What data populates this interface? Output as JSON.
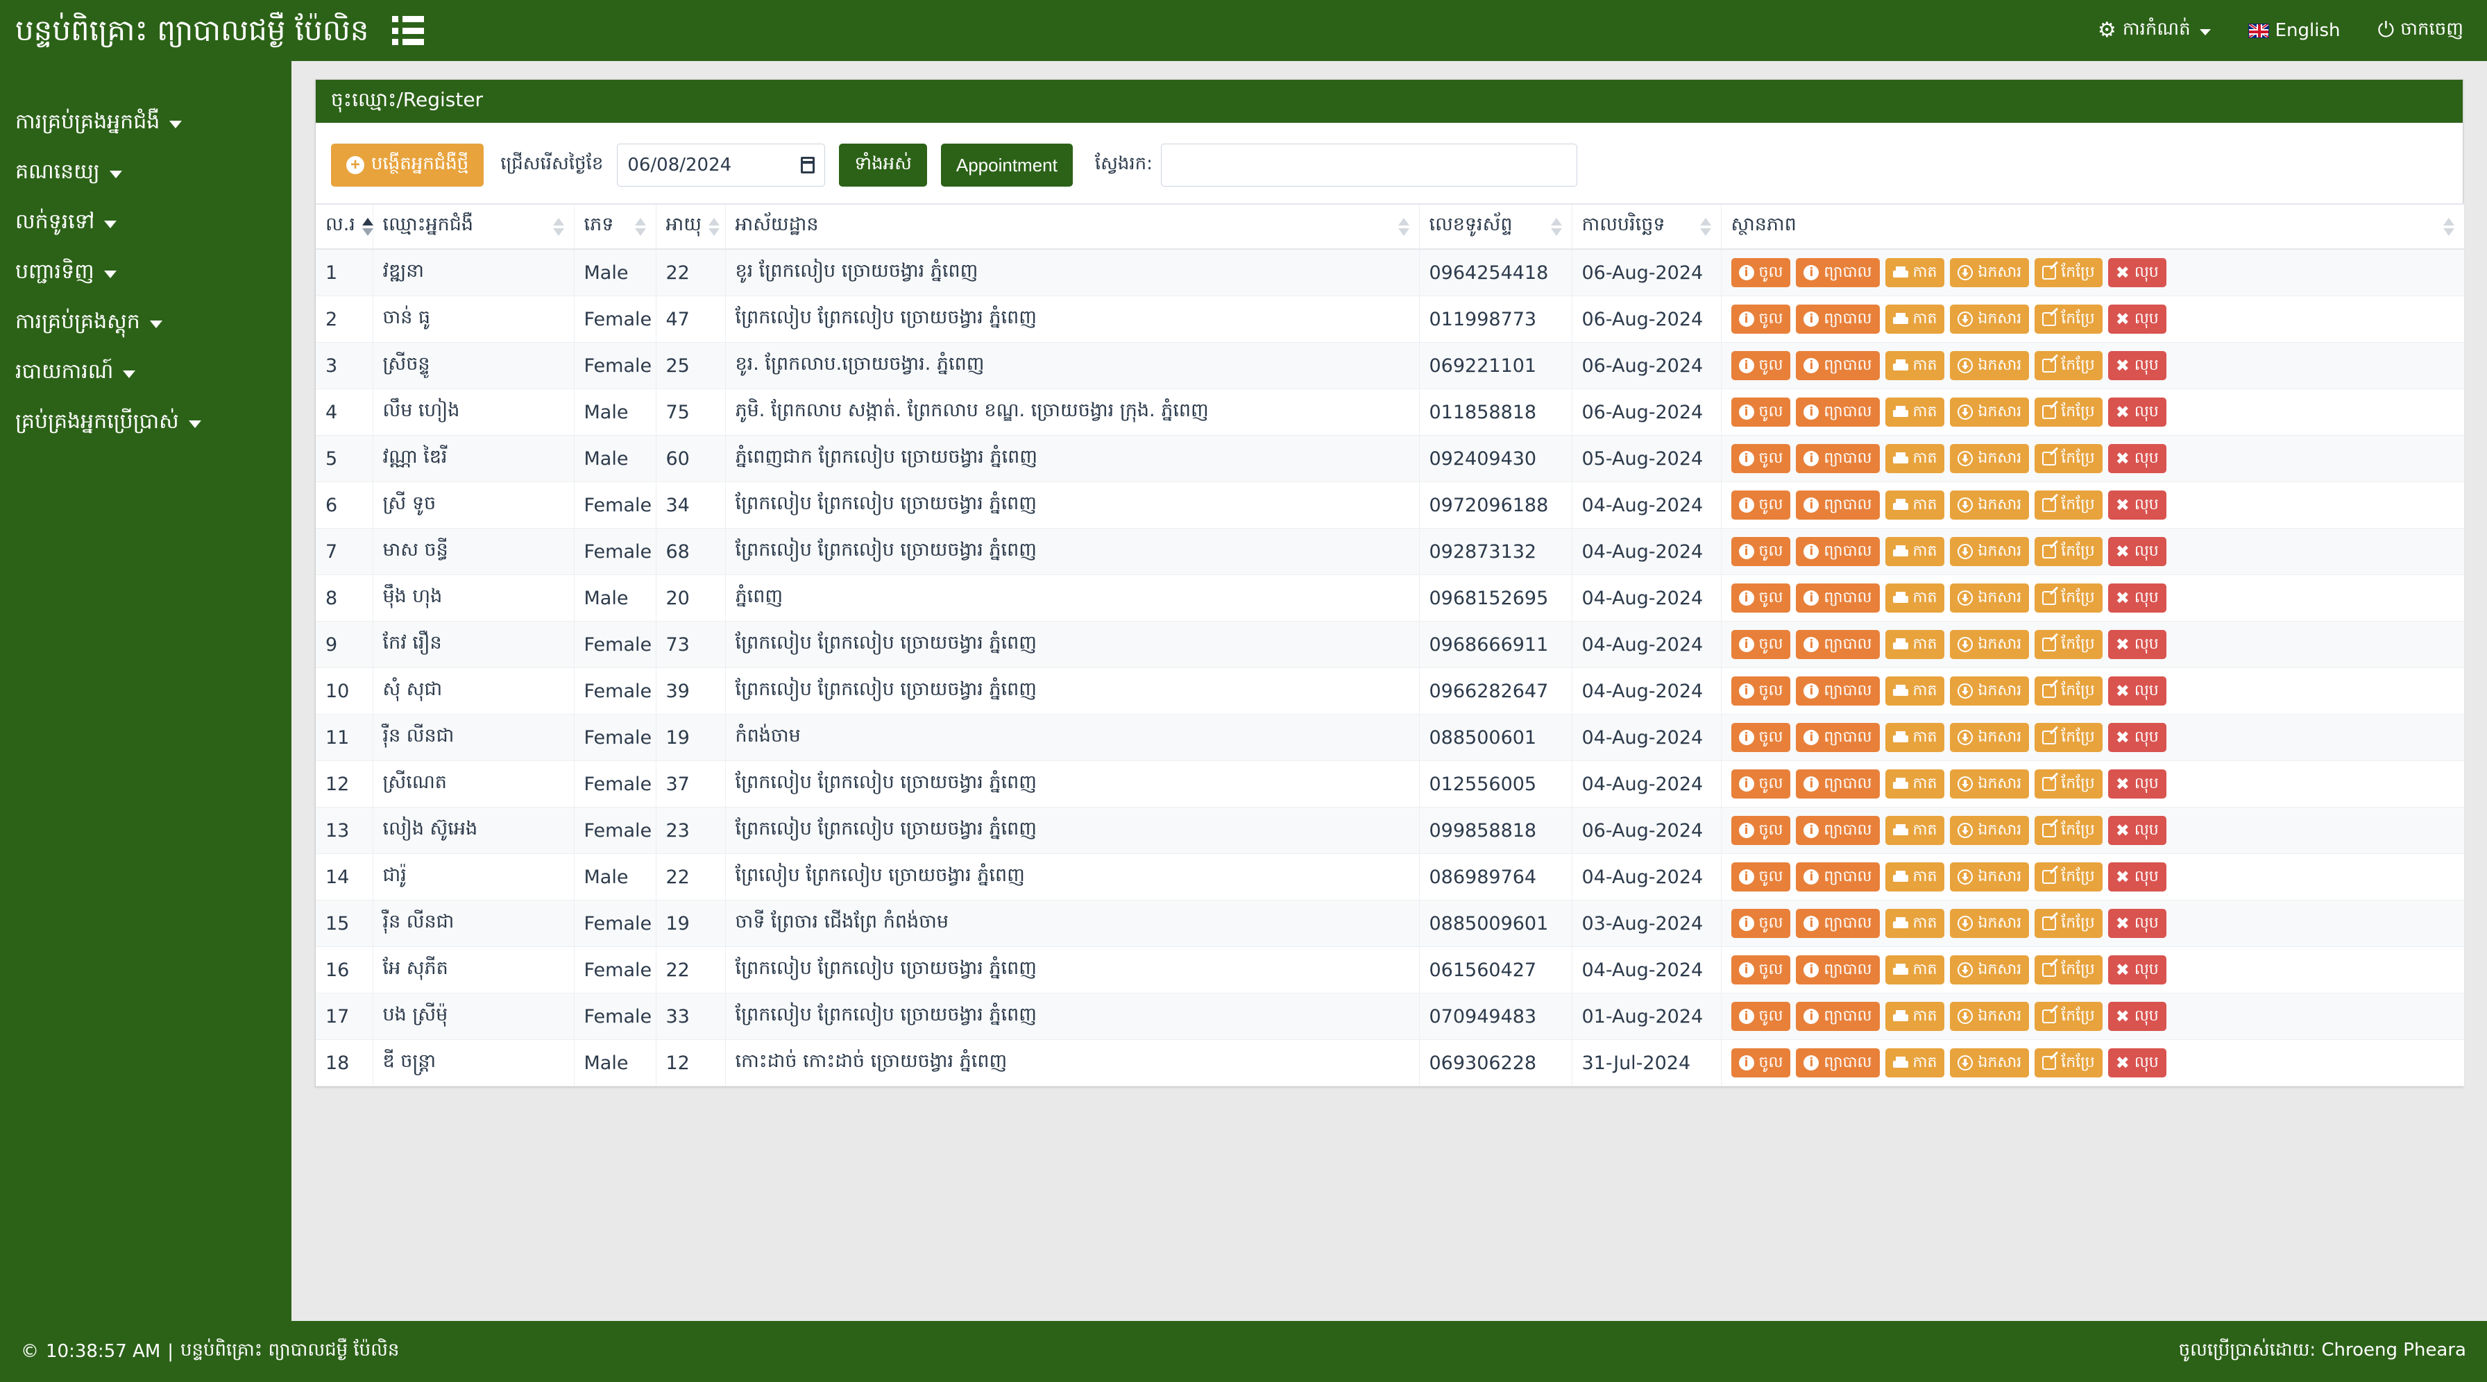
{
  "colors": {
    "brand_green": "#2c6218",
    "accent_orange_dark": "#e8803a",
    "accent_orange_light": "#e8a33d",
    "danger_red": "#d9534f",
    "text_dark": "#2c3a4b",
    "row_alt": "#f8f9fa"
  },
  "navbar": {
    "brand_title": "បន្ទប់ពិគ្រោះ ព្យាបាលជម្ងឺ ប៉ែលិន",
    "menu_toggle_icon": "hamburger-list-icon",
    "settings": {
      "label": "ការកំណត់",
      "icon": "gear-icon",
      "caret": "chevron-down-icon"
    },
    "language": {
      "label": "English",
      "icon": "uk-flag-icon"
    },
    "logout": {
      "label": "ចាកចេញ",
      "icon": "power-icon"
    }
  },
  "sidebar": {
    "items": [
      {
        "label": "ការគ្រប់គ្រងអ្នកជំងឺ",
        "caret": "chevron-down-icon"
      },
      {
        "label": "គណនេយ្យ",
        "caret": "chevron-down-icon"
      },
      {
        "label": "លក់ទូរទៅ",
        "caret": "chevron-down-icon"
      },
      {
        "label": "បញ្ជារទិញ",
        "caret": "chevron-down-icon"
      },
      {
        "label": "ការគ្រប់គ្រងស្តុក",
        "caret": "chevron-down-icon"
      },
      {
        "label": "របាយការណ៍",
        "caret": "chevron-down-icon"
      },
      {
        "label": "គ្រប់គ្រងអ្នកប្រើប្រាស់",
        "caret": "chevron-down-icon"
      }
    ]
  },
  "panel": {
    "title": "ចុះឈ្មោះ/Register"
  },
  "toolbar": {
    "new_patient_label": "បង្ថើតអ្នកជំងឺថ្មី",
    "new_patient_icon": "plus-circle-icon",
    "date_filter_label": "ជ្រើសរើសថ្ងៃខែ",
    "date_value": "06/08/2024",
    "date_icon": "calendar-icon",
    "submit_label": "ទាំងអស់",
    "appointment_label": "Appointment",
    "search_label": "ស្វែងរក:",
    "search_value": "",
    "search_placeholder": ""
  },
  "table": {
    "columns": [
      {
        "key": "no",
        "label": "ល.រ",
        "sortable": true,
        "sort_active": true
      },
      {
        "key": "name",
        "label": "ឈ្មោះអ្នកជំងឺ",
        "sortable": true,
        "sort_active": false
      },
      {
        "key": "sex",
        "label": "ភេទ",
        "sortable": true,
        "sort_active": false
      },
      {
        "key": "age",
        "label": "អាយុ",
        "sortable": true,
        "sort_active": false
      },
      {
        "key": "address",
        "label": "អាស័យដ្ឋាន",
        "sortable": true,
        "sort_active": false
      },
      {
        "key": "phone",
        "label": "លេខទូរស័ព្ទ",
        "sortable": true,
        "sort_active": false
      },
      {
        "key": "date",
        "label": "កាលបរិច្ឆេទ",
        "sortable": true,
        "sort_active": false
      },
      {
        "key": "status",
        "label": "ស្ថានភាព",
        "sortable": true,
        "sort_active": false
      }
    ],
    "row_actions": [
      {
        "key": "enter",
        "label": "ចូល",
        "icon": "info-circle-icon",
        "style": "o1"
      },
      {
        "key": "treat",
        "label": "ព្យាបាល",
        "icon": "info-circle-icon",
        "style": "o1"
      },
      {
        "key": "print",
        "label": "កាត",
        "icon": "printer-icon",
        "style": "o2"
      },
      {
        "key": "download",
        "label": "ឯកសារ",
        "icon": "download-circle-icon",
        "style": "o2"
      },
      {
        "key": "edit",
        "label": "កែប្រែ",
        "icon": "edit-pencil-icon",
        "style": "o2"
      },
      {
        "key": "delete",
        "label": "លុប",
        "icon": "close-x-icon",
        "style": "red"
      }
    ],
    "rows": [
      {
        "no": "1",
        "name": "វឌ្ឍនា",
        "sex": "Male",
        "age": "22",
        "address": "ខូរ ព្រែកលៀប ច្រោយចង្វារ ភ្នំពេញ",
        "phone": "0964254418",
        "date": "06-Aug-2024"
      },
      {
        "no": "2",
        "name": "ចាន់ ធូ",
        "sex": "Female",
        "age": "47",
        "address": "ព្រែកលៀប ព្រែកលៀប ច្រោយចង្វារ ភ្នំពេញ",
        "phone": "011998773",
        "date": "06-Aug-2024"
      },
      {
        "no": "3",
        "name": "ស្រីចន្ទូ",
        "sex": "Female",
        "age": "25",
        "address": "ខូរ. ព្រែកលាប.ច្រោយចង្វារ. ភ្នំពេញ",
        "phone": "069221101",
        "date": "06-Aug-2024"
      },
      {
        "no": "4",
        "name": "លឹម ហៀង",
        "sex": "Male",
        "age": "75",
        "address": "ភូមិ. ព្រែកលាប សង្កាត់. ព្រែកលាប ខណ្ឌ. ច្រោយចង្វារ ក្រុង. ភ្នំពេញ",
        "phone": "011858818",
        "date": "06-Aug-2024"
      },
      {
        "no": "5",
        "name": "វណ្ណា ឌៃរី",
        "sex": "Male",
        "age": "60",
        "address": "ភ្នំពេញជាក ព្រែកលៀប ច្រោយចង្វារ ភ្នំពេញ",
        "phone": "092409430",
        "date": "05-Aug-2024"
      },
      {
        "no": "6",
        "name": "ស្រី ទូច",
        "sex": "Female",
        "age": "34",
        "address": "ព្រែកលៀប ព្រែកលៀប ច្រោយចង្វារ ភ្នំពេញ",
        "phone": "0972096188",
        "date": "04-Aug-2024"
      },
      {
        "no": "7",
        "name": "មាស ចន្ធី",
        "sex": "Female",
        "age": "68",
        "address": "ព្រែកលៀប ព្រែកលៀប ច្រោយចង្វារ ភ្នំពេញ",
        "phone": "092873132",
        "date": "04-Aug-2024"
      },
      {
        "no": "8",
        "name": "ម៉ឹង ហុង",
        "sex": "Male",
        "age": "20",
        "address": "ភ្នំពេញ",
        "phone": "0968152695",
        "date": "04-Aug-2024"
      },
      {
        "no": "9",
        "name": "កែវ រឿន",
        "sex": "Female",
        "age": "73",
        "address": "ព្រែកលៀប ព្រែកលៀប ច្រោយចង្វារ ភ្នំពេញ",
        "phone": "0968666911",
        "date": "04-Aug-2024"
      },
      {
        "no": "10",
        "name": "សុំ សុជា",
        "sex": "Female",
        "age": "39",
        "address": "ព្រែកលៀប ព្រែកលៀប ច្រោយចង្វារ ភ្នំពេញ",
        "phone": "0966282647",
        "date": "04-Aug-2024"
      },
      {
        "no": "11",
        "name": "រ៉ឺន លីនជា",
        "sex": "Female",
        "age": "19",
        "address": "កំពង់ចាម",
        "phone": "088500601",
        "date": "04-Aug-2024"
      },
      {
        "no": "12",
        "name": "ស្រីណេត",
        "sex": "Female",
        "age": "37",
        "address": "ព្រែកលៀប ព្រែកលៀប ច្រោយចង្វារ ភ្នំពេញ",
        "phone": "012556005",
        "date": "04-Aug-2024"
      },
      {
        "no": "13",
        "name": "លៀង ស៊ូអេង",
        "sex": "Female",
        "age": "23",
        "address": "ព្រែកលៀប ព្រែកលៀប ច្រោយចង្វារ ភ្នំពេញ",
        "phone": "099858818",
        "date": "06-Aug-2024"
      },
      {
        "no": "14",
        "name": "ជារ៉ូ",
        "sex": "Male",
        "age": "22",
        "address": "ព្រែលៀប ព្រែកលៀប ច្រោយចង្វារ ភ្នំពេញ",
        "phone": "086989764",
        "date": "04-Aug-2024"
      },
      {
        "no": "15",
        "name": "រ៉ឺន លីនជា",
        "sex": "Female",
        "age": "19",
        "address": "ចាទី ព្រែចារ ជើងព្រែ កំពង់ចាម",
        "phone": "0885009601",
        "date": "03-Aug-2024"
      },
      {
        "no": "16",
        "name": "អែ សុភីត",
        "sex": "Female",
        "age": "22",
        "address": "ព្រែកលៀប ព្រែកលៀប ច្រោយចង្វារ ភ្នំពេញ",
        "phone": "061560427",
        "date": "04-Aug-2024"
      },
      {
        "no": "17",
        "name": "បង ស្រីម៉ុ",
        "sex": "Female",
        "age": "33",
        "address": "ព្រែកលៀប ព្រែកលៀប ច្រោយចង្វារ ភ្នំពេញ",
        "phone": "070949483",
        "date": "01-Aug-2024"
      },
      {
        "no": "18",
        "name": "ឌី ចន្ត្រា",
        "sex": "Male",
        "age": "12",
        "address": "កោះដាច់ កោះដាច់ ច្រោយចង្វារ ភ្នំពេញ",
        "phone": "069306228",
        "date": "31-Jul-2024"
      }
    ]
  },
  "footer": {
    "copyright_symbol": "©",
    "time": "10:38:57 AM",
    "separator": "|",
    "clinic_name": "បន្ទប់ពិគ្រោះ ព្យាបាលជម្ងឺ ប៉ែលិន",
    "login_as": "ចូលប្រើប្រាស់ដោយ: Chroeng Pheara"
  }
}
